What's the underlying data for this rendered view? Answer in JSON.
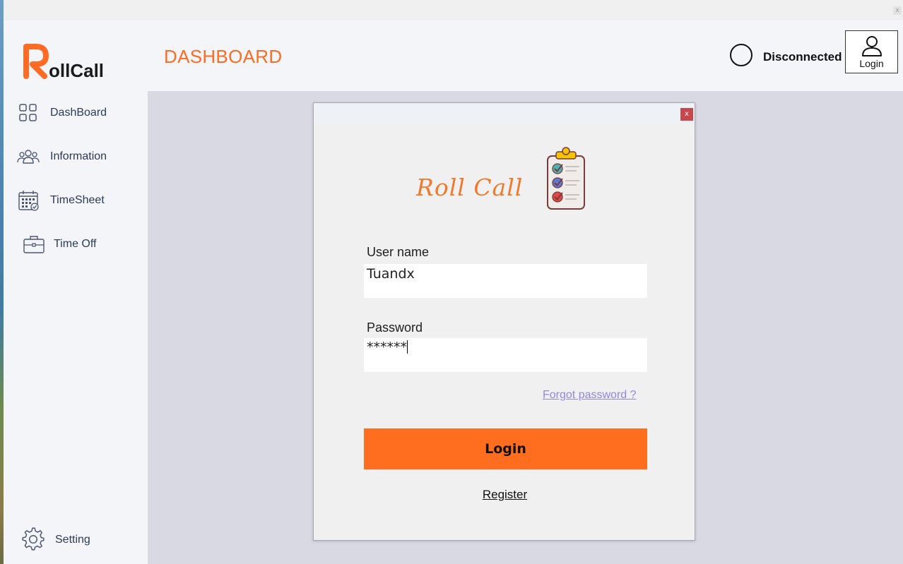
{
  "app": {
    "logo_text": "ollCall",
    "logo_initial": "R",
    "accent_color": "#ff6b23"
  },
  "header": {
    "title": "DASHBOARD",
    "status_text": "Disconnected",
    "login_button_label": "Login",
    "login_icon": "user-icon"
  },
  "sidebar": {
    "items": [
      {
        "label": "DashBoard",
        "icon": "grid-icon"
      },
      {
        "label": "Information",
        "icon": "users-icon"
      },
      {
        "label": "TimeSheet",
        "icon": "calendar-icon"
      },
      {
        "label": "Time Off",
        "icon": "briefcase-icon"
      }
    ],
    "setting": {
      "label": "Setting",
      "icon": "gear-icon"
    }
  },
  "dialog": {
    "close_label": "x",
    "brand": "Roll Call",
    "brand_icon": "clipboard-checklist-icon",
    "username_label": "User name",
    "username_value": "Tuandx",
    "password_label": "Password",
    "password_value": "******",
    "forgot_label": "Forgot password ?",
    "login_label": "Login",
    "register_label": "Register"
  },
  "window": {
    "close_label": "x"
  }
}
